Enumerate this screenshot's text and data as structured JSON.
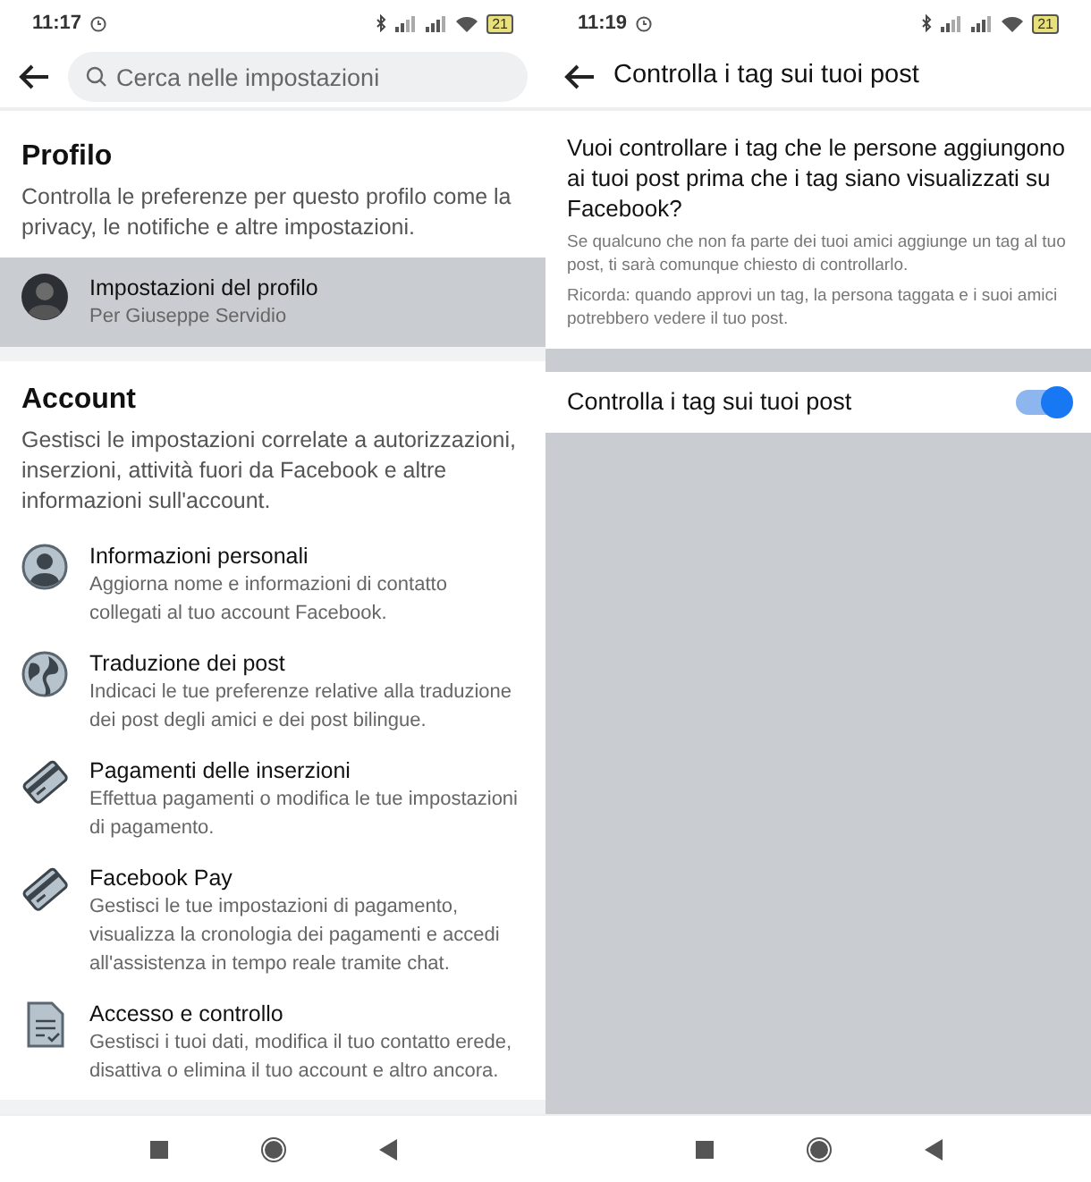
{
  "screens": [
    {
      "status_bar": {
        "time": "11:17",
        "battery": "21"
      },
      "search": {
        "placeholder": "Cerca nelle impostazioni"
      },
      "sections": [
        {
          "title": "Profilo",
          "description": "Controlla le preferenze per questo profilo come la privacy, le notifiche e altre impostazioni.",
          "items": [
            {
              "kind": "avatar",
              "title": "Impostazioni del profilo",
              "subtitle": "Per Giuseppe Servidio",
              "selected": true
            }
          ]
        },
        {
          "title": "Account",
          "description": "Gestisci le impostazioni correlate a autorizzazioni, inserzioni, attività fuori da Facebook e altre informazioni sull'account.",
          "items": [
            {
              "kind": "person",
              "title": "Informazioni personali",
              "subtitle": "Aggiorna nome e informazioni di contatto collegati al tuo account Facebook.",
              "selected": false
            },
            {
              "kind": "globe",
              "title": "Traduzione dei post",
              "subtitle": "Indicaci le tue preferenze relative alla traduzione dei post degli amici e dei post bilingue.",
              "selected": false
            },
            {
              "kind": "card",
              "title": "Pagamenti delle inserzioni",
              "subtitle": "Effettua pagamenti o modifica le tue impostazioni di pagamento.",
              "selected": false
            },
            {
              "kind": "card",
              "title": "Facebook Pay",
              "subtitle": "Gestisci le tue impostazioni di pagamento, visualizza la cronologia dei pagamenti e accedi all'assistenza in tempo reale tramite chat.",
              "selected": false
            },
            {
              "kind": "document",
              "title": "Accesso e controllo",
              "subtitle": "Gestisci i tuoi dati, modifica il tuo contatto erede, disattiva o elimina il tuo account e altro ancora.",
              "selected": false
            }
          ]
        }
      ]
    },
    {
      "status_bar": {
        "time": "11:19",
        "battery": "21"
      },
      "title": "Controlla i tag sui tuoi post",
      "question": "Vuoi controllare i tag che le persone aggiungono ai tuoi post prima che i tag siano visualizzati su Facebook?",
      "notes": [
        "Se qualcuno che non fa parte dei tuoi amici aggiunge un tag al tuo post, ti sarà comunque chiesto di controllarlo.",
        "Ricorda: quando approvi un tag, la persona taggata e i suoi amici potrebbero vedere il tuo post."
      ],
      "toggle": {
        "label": "Controlla i tag sui tuoi post",
        "on": true
      }
    }
  ]
}
